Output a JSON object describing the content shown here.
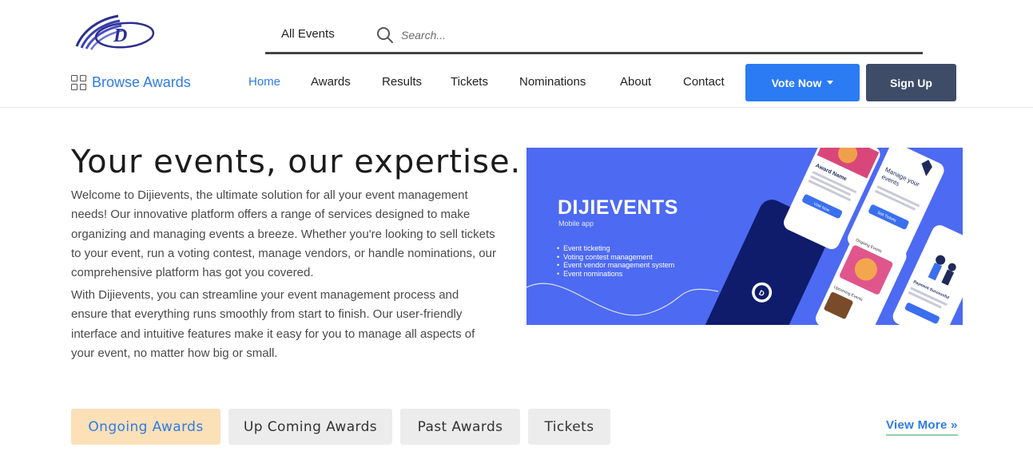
{
  "header": {
    "all_events": "All Events",
    "search_placeholder": "Search...",
    "browse_awards": "Browse Awards",
    "nav": [
      "Home",
      "Awards",
      "Results",
      "Tickets",
      "Nominations",
      "About",
      "Contact"
    ],
    "vote_now": "Vote Now",
    "sign_up": "Sign Up"
  },
  "hero": {
    "title": "Your events, our expertise.",
    "paragraph1": "Welcome to Dijievents, the ultimate solution for all your event management needs! Our innovative platform offers a range of services designed to make organizing and managing events a breeze. Whether you're looking to sell tickets to your event, run a voting contest, manage vendors, or handle nominations, our comprehensive platform has got you covered.",
    "paragraph2": "With Dijievents, you can streamline your event management process and ensure that everything runs smoothly from start to finish. Our user-friendly interface and intuitive features make it easy for you to manage all aspects of your event, no matter how big or small."
  },
  "banner": {
    "title": "DIJIEVENTS",
    "subtitle": "Mobile app",
    "features": [
      "Event ticketing",
      "Voting contest management",
      "Event vendor management system",
      "Event nominations"
    ],
    "card1_title": "Award Name",
    "card1_button": "Vote Now",
    "card2_title": "Manage your events",
    "card2_button": "Sell Tickets",
    "card3_title": "Ongoing Events",
    "card3_sub": "Upcoming Events",
    "card4_title": "Payment Successful"
  },
  "tabs": [
    "Ongoing Awards",
    "Up Coming Awards",
    "Past Awards",
    "Tickets"
  ],
  "view_more": "View More »",
  "colors": {
    "accent": "#2e7be6",
    "vote_button": "#2b7bf3",
    "signup_button": "#3e4c67",
    "banner_bg": "#4d6af2",
    "active_tab_bg": "#fbe0b8"
  }
}
